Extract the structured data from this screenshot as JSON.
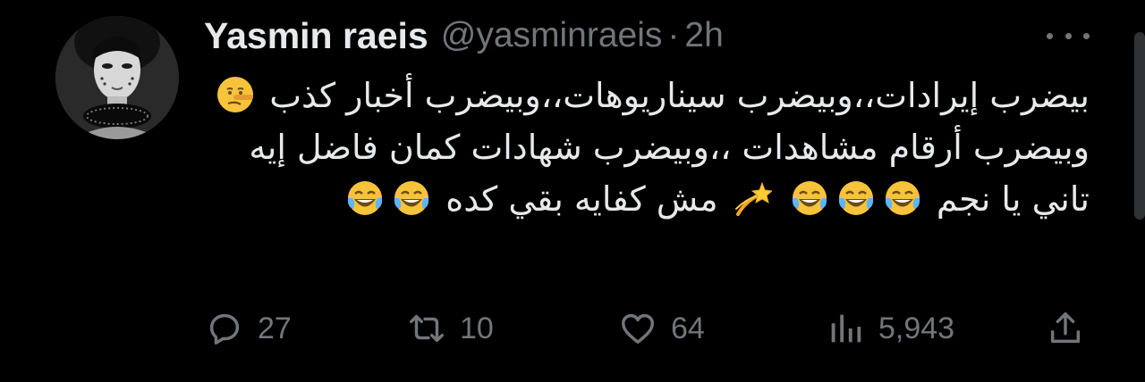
{
  "tweet": {
    "author": {
      "display_name": "Yasmin raeis",
      "handle": "@yasminraeis",
      "avatar_icon": "profile-photo"
    },
    "separator": "·",
    "timestamp": "2h",
    "text_segments": [
      "بيضرب إيرادات،،وبيضرب سيناريوهات،،وبيضرب أخبار كذب",
      "وبيضرب أرقام مشاهدات ،،وبيضرب شهادات كمان",
      "فاضل إيه تاني يا نجم",
      "مش كفايه بقي كده"
    ],
    "emojis": {
      "lying_face": "🤥",
      "dizzy": "💫",
      "tears_of_joy": "😂"
    }
  },
  "actions": {
    "reply_count": "27",
    "retweet_count": "10",
    "like_count": "64",
    "views_count": "5,943"
  },
  "colors": {
    "background": "#000000",
    "text": "#e7e9ea",
    "secondary": "#71767b"
  }
}
